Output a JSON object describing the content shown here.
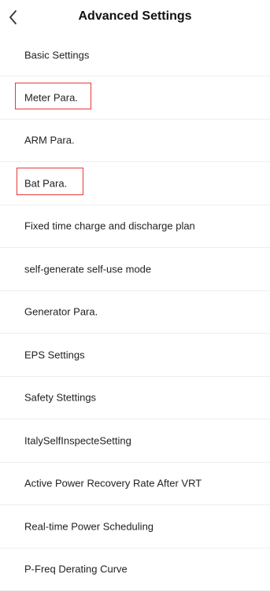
{
  "header": {
    "title": "Advanced Settings",
    "back_icon": "chevron-left-icon"
  },
  "highlight_color": "#e53935",
  "menu": {
    "items": [
      {
        "label": "Basic Settings",
        "highlighted": false
      },
      {
        "label": "Meter Para.",
        "highlighted": true
      },
      {
        "label": "ARM Para.",
        "highlighted": false
      },
      {
        "label": "Bat Para.",
        "highlighted": true
      },
      {
        "label": "Fixed time charge and discharge plan",
        "highlighted": false
      },
      {
        "label": "self-generate self-use mode",
        "highlighted": false
      },
      {
        "label": "Generator Para.",
        "highlighted": false
      },
      {
        "label": "EPS Settings",
        "highlighted": false
      },
      {
        "label": "Safety Stettings",
        "highlighted": false
      },
      {
        "label": "ItalySelfInspecteSetting",
        "highlighted": false
      },
      {
        "label": "Active Power Recovery Rate After VRT",
        "highlighted": false
      },
      {
        "label": "Real-time Power Scheduling",
        "highlighted": false
      },
      {
        "label": "P-Freq Derating Curve",
        "highlighted": false
      }
    ]
  }
}
